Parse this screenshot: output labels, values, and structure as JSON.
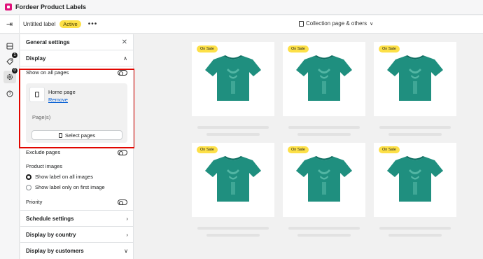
{
  "app": {
    "title": "Fordeer Product Labels"
  },
  "toolbar": {
    "label_name": "Untitled label",
    "status": "Active",
    "more": "•••",
    "page_selector": "Collection page & others",
    "back_icon": "exit-icon"
  },
  "rail": {
    "items": [
      {
        "icon": "layout-icon",
        "badge": ""
      },
      {
        "icon": "tag-icon",
        "badge": "1"
      },
      {
        "icon": "gear-icon",
        "badge": "0"
      },
      {
        "icon": "help-icon",
        "badge": ""
      }
    ]
  },
  "panel": {
    "title": "General settings",
    "display": {
      "title": "Display",
      "show_on_all_pages": "Show on all pages",
      "page": {
        "name": "Home page",
        "remove": "Remove"
      },
      "pages_label": "Page(s)",
      "select_pages": "Select pages",
      "exclude_pages": "Exclude pages",
      "product_images": {
        "label": "Product images",
        "options": [
          "Show label on all images",
          "Show label only on first image"
        ],
        "selected": "Show label on all images"
      },
      "priority": "Priority"
    },
    "sections": [
      "Schedule settings",
      "Display by country",
      "Display by customers"
    ]
  },
  "products": {
    "badge": "On Sale",
    "shirt_color": "#1f8f7f",
    "items": [
      {
        "badge": "On Sale"
      },
      {
        "badge": "On Sale"
      },
      {
        "badge": "On Sale"
      },
      {
        "badge": "On Sale"
      },
      {
        "badge": "On Sale"
      },
      {
        "badge": "On Sale"
      }
    ]
  },
  "colors": {
    "accent": "#fde047",
    "link": "#005bd3",
    "highlight": "#e10600",
    "logo": "#e0107a"
  }
}
